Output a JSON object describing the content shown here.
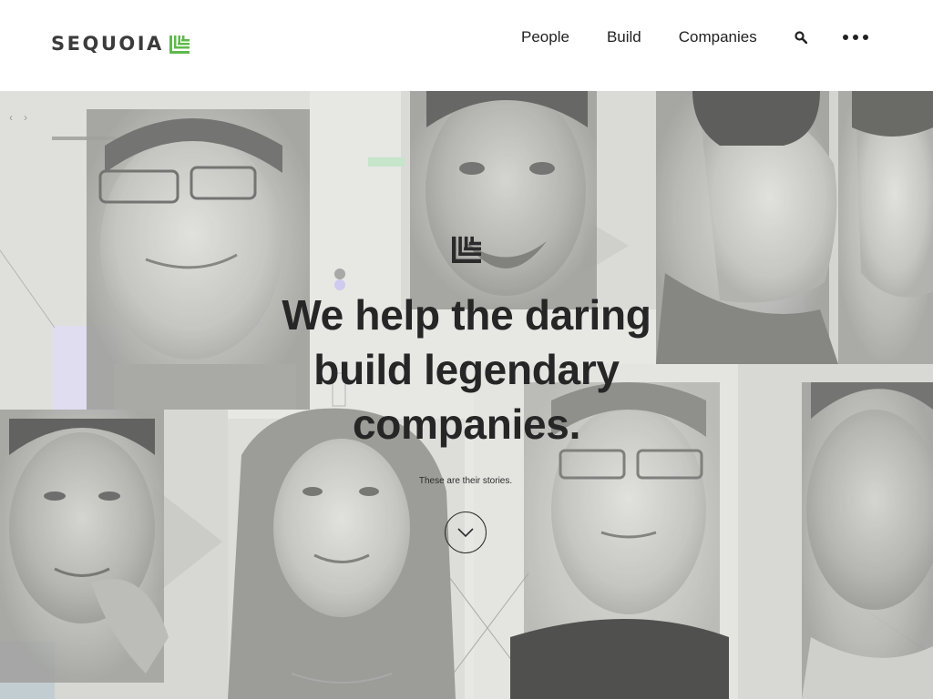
{
  "brand": {
    "name": "SEQUOIA",
    "accent_color": "#5fb94d"
  },
  "nav": {
    "links": [
      "People",
      "Build",
      "Companies"
    ],
    "search_icon": "search-icon",
    "more_icon": "more-dots-icon"
  },
  "hero": {
    "carousel_prev": "‹",
    "carousel_next": "›",
    "headline_lines": [
      "We help the daring",
      "build legendary",
      "companies."
    ],
    "subline": "These are their stories.",
    "scroll_icon": "chevron-down-icon"
  },
  "colors": {
    "text": "#262626",
    "hero_bg": "#e9e9e6",
    "accent_green": "#5fb94d",
    "accent_purple": "#c9c3ef"
  }
}
